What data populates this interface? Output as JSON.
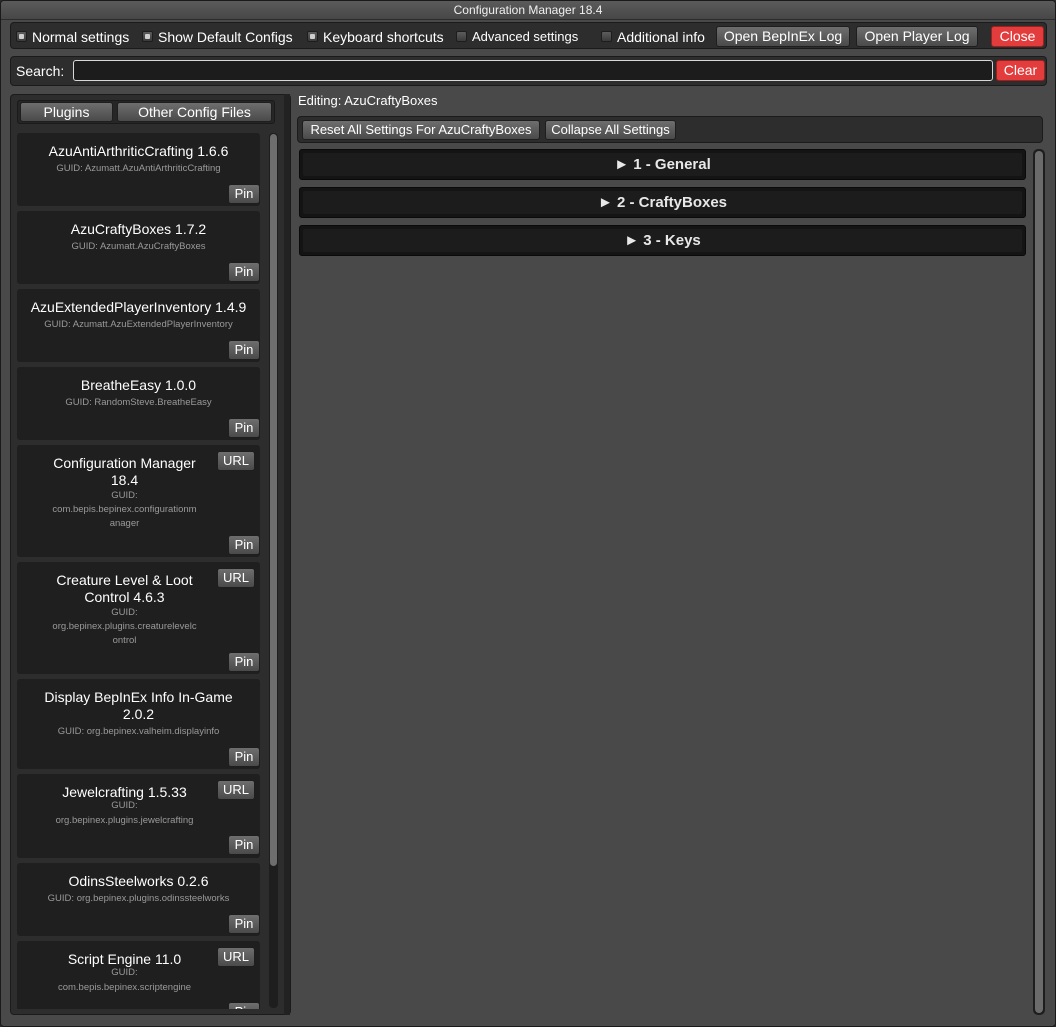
{
  "window": {
    "title": "Configuration Manager 18.4"
  },
  "toolbar": {
    "checks": [
      {
        "label": "Normal settings",
        "checked": true
      },
      {
        "label": "Show Default Configs",
        "checked": true
      },
      {
        "label": "Keyboard shortcuts",
        "checked": true
      },
      {
        "label": "Advanced settings",
        "checked": false
      },
      {
        "label": "Additional info",
        "checked": false
      }
    ],
    "open_bepinex_log": "Open BepInEx Log",
    "open_player_log": "Open Player Log",
    "close": "Close"
  },
  "search": {
    "label": "Search:",
    "value": "",
    "clear": "Clear"
  },
  "left": {
    "tabs": [
      "Plugins",
      "Other Config Files"
    ],
    "pin_label": "Pin",
    "url_label": "URL",
    "plugins": [
      {
        "name": "AzuAntiArthriticCrafting 1.6.6",
        "guid": "GUID: Azumatt.AzuAntiArthriticCrafting"
      },
      {
        "name": "AzuCraftyBoxes 1.7.2",
        "guid": "GUID: Azumatt.AzuCraftyBoxes"
      },
      {
        "name": "AzuExtendedPlayerInventory 1.4.9",
        "guid": "GUID: Azumatt.AzuExtendedPlayerInventory"
      },
      {
        "name": "BreatheEasy 1.0.0",
        "guid": "GUID: RandomSteve.BreatheEasy"
      },
      {
        "name": "Configuration Manager\n18.4",
        "guid": "GUID:\ncom.bepis.bepinex.configurationm\nanager",
        "url": true
      },
      {
        "name": "Creature Level & Loot\nControl 4.6.3",
        "guid": "GUID:\norg.bepinex.plugins.creaturelevelc\nontrol",
        "url": true
      },
      {
        "name": "Display BepInEx Info In-Game\n2.0.2",
        "guid": "GUID: org.bepinex.valheim.displayinfo"
      },
      {
        "name": "Jewelcrafting 1.5.33",
        "guid": "GUID:\norg.bepinex.plugins.jewelcrafting",
        "url": true
      },
      {
        "name": "OdinsSteelworks 0.2.6",
        "guid": "GUID: org.bepinex.plugins.odinssteelworks"
      },
      {
        "name": "Script Engine 11.0",
        "guid": "GUID:\ncom.bepis.bepinex.scriptengine",
        "url": true
      }
    ]
  },
  "right": {
    "editing": "Editing: AzuCraftyBoxes",
    "reset_all": "Reset All Settings For AzuCraftyBoxes",
    "collapse_all": "Collapse All Settings",
    "sections": [
      "► 1 - General",
      "► 2 - CraftyBoxes",
      "► 3 - Keys"
    ]
  },
  "colors": {
    "accent_red": "#e23c3c",
    "panel": "#2d2d2d",
    "background": "#494949"
  }
}
